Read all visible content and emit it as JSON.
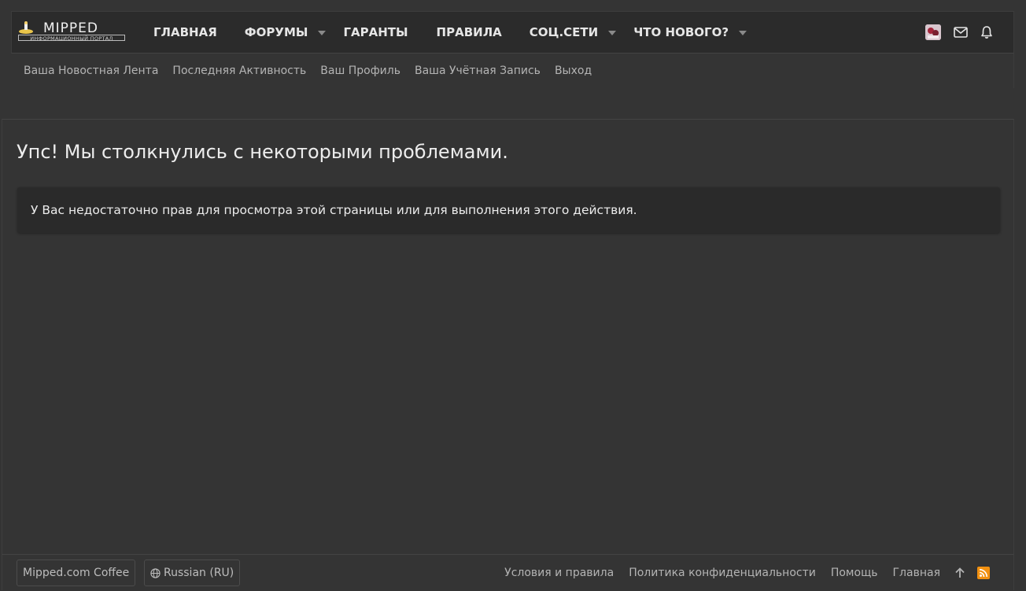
{
  "logo": {
    "title": "MIPPED",
    "subtitle": "ИНФОРМАЦИОННЫЙ ПОРТАЛ"
  },
  "nav": {
    "items": [
      {
        "label": "ГЛАВНАЯ",
        "has_dropdown": false
      },
      {
        "label": "ФОРУМЫ",
        "has_dropdown": true
      },
      {
        "label": "ГАРАНТЫ",
        "has_dropdown": false
      },
      {
        "label": "ПРАВИЛА",
        "has_dropdown": false
      },
      {
        "label": "СОЦ.СЕТИ",
        "has_dropdown": true
      },
      {
        "label": "ЧТО НОВОГО?",
        "has_dropdown": true
      }
    ],
    "icons": [
      "avatar",
      "envelope-icon",
      "bell-icon"
    ]
  },
  "subnav": {
    "items": [
      {
        "label": "Ваша Новостная Лента"
      },
      {
        "label": "Последняя Активность"
      },
      {
        "label": "Ваш Профиль"
      },
      {
        "label": "Ваша Учётная Запись"
      },
      {
        "label": "Выход"
      }
    ]
  },
  "main": {
    "title": "Упс! Мы столкнулись с некоторыми проблемами.",
    "message": "У Вас недостаточно прав для просмотра этой страницы или для выполнения этого действия."
  },
  "footer": {
    "style_button": "Mipped.com Coffee",
    "language_button": "Russian (RU)",
    "links": [
      {
        "label": "Условия и правила"
      },
      {
        "label": "Политика конфиденциальности"
      },
      {
        "label": "Помощь"
      },
      {
        "label": "Главная"
      }
    ],
    "icons": [
      "arrow-up-icon",
      "rss-icon"
    ]
  },
  "colors": {
    "background": "#343434",
    "header": "#2b2b2b",
    "notice": "#2a2a2a",
    "rss": "#f29111"
  }
}
